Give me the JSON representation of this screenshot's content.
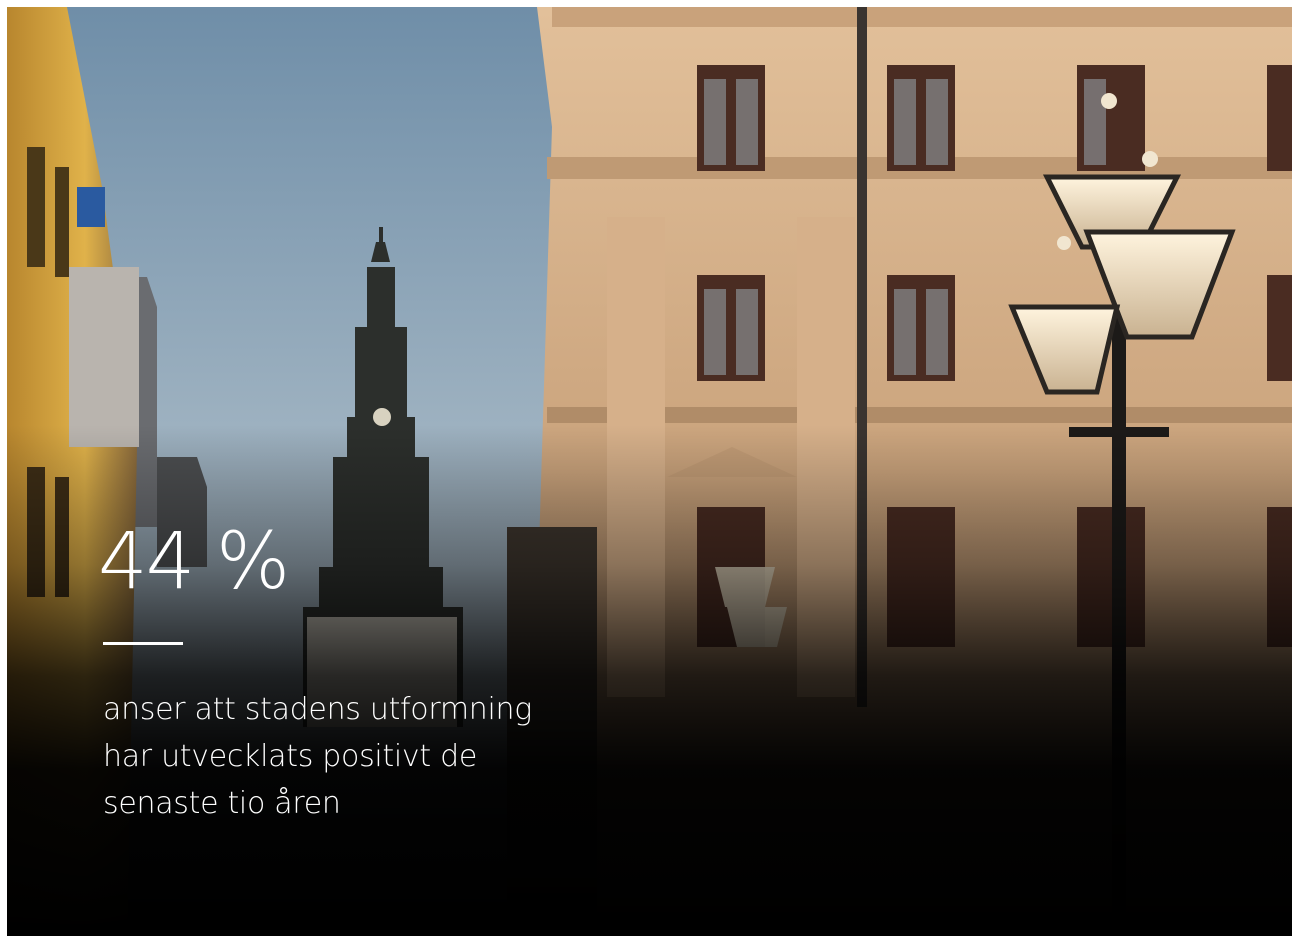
{
  "stat": {
    "value": "44 %",
    "caption_lines": [
      "anser att stadens utformning",
      "har utvecklats positivt de",
      "senaste tio åren"
    ]
  },
  "colors": {
    "text": "#ffffff",
    "sky": "#7f9bb0",
    "facade": "#d8b48c",
    "overlay": "#000000"
  }
}
